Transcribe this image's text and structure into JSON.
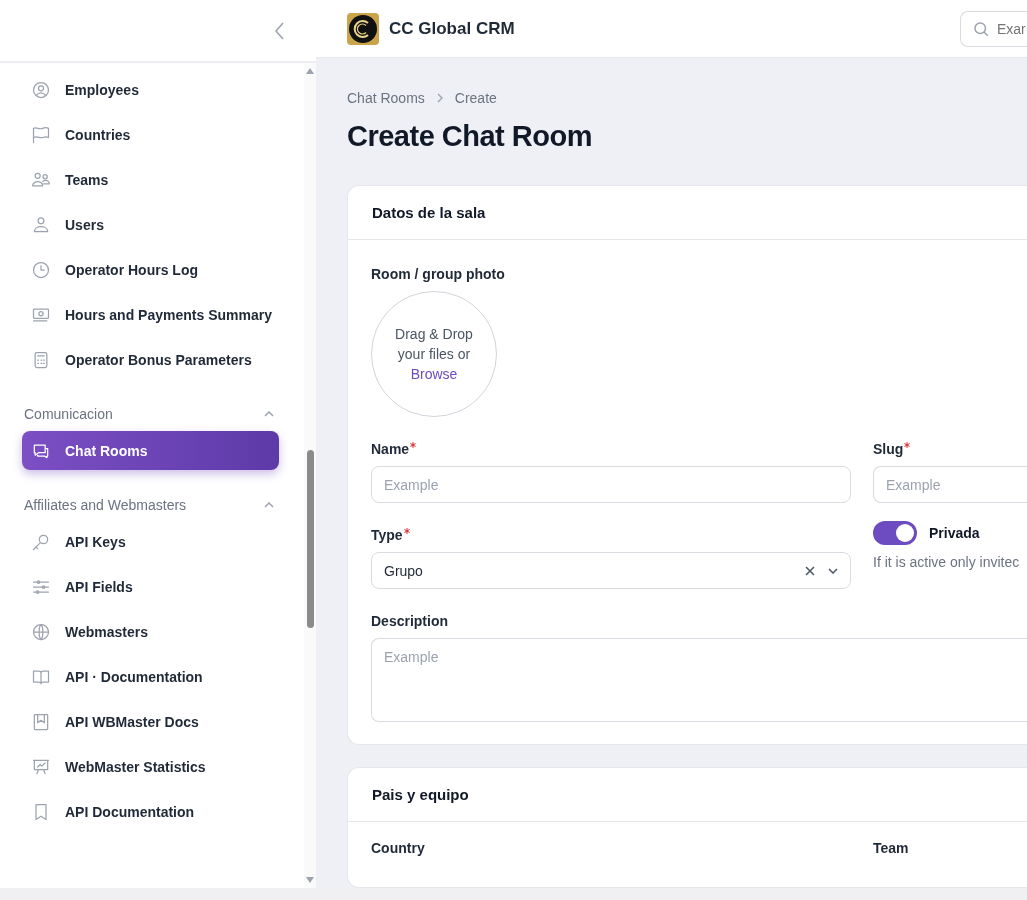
{
  "app": {
    "name": "CC Global CRM",
    "search": {
      "placeholder": "Exar"
    }
  },
  "sidebar": {
    "items": [
      {
        "label": "Employees",
        "selected": false
      },
      {
        "label": "Countries",
        "selected": false
      },
      {
        "label": "Teams",
        "selected": false
      },
      {
        "label": "Users",
        "selected": false
      },
      {
        "label": "Operator Hours Log",
        "selected": false
      },
      {
        "label": "Hours and Payments Summary",
        "selected": false
      },
      {
        "label": "Operator Bonus Parameters",
        "selected": false
      }
    ],
    "groups": [
      {
        "label": "Comunicacion",
        "expanded": true,
        "items": [
          {
            "label": "Chat Rooms",
            "selected": true
          }
        ]
      },
      {
        "label": "Affiliates and Webmasters",
        "expanded": true,
        "items": [
          {
            "label": "API Keys",
            "selected": false
          },
          {
            "label": "API Fields",
            "selected": false
          },
          {
            "label": "Webmasters",
            "selected": false
          },
          {
            "label": "API · Documentation",
            "selected": false
          },
          {
            "label": "API WBMaster Docs",
            "selected": false
          },
          {
            "label": "WebMaster Statistics",
            "selected": false
          },
          {
            "label": "API Documentation",
            "selected": false
          }
        ]
      }
    ]
  },
  "breadcrumbs": [
    "Chat Rooms",
    "Create"
  ],
  "title": "Create Chat Room",
  "sections": [
    {
      "title": "Datos de la sala",
      "photo": {
        "label": "Room / group photo",
        "text": "Drag & Drop your files or",
        "link": "Browse"
      },
      "name": {
        "label": "Name",
        "required": true,
        "placeholder": "Example"
      },
      "slug": {
        "label": "Slug",
        "required": true,
        "placeholder": "Example"
      },
      "type": {
        "label": "Type",
        "required": true,
        "value": "Grupo"
      },
      "private": {
        "label": "Privada",
        "on": true,
        "hint": "If it is active only invitec"
      },
      "description": {
        "label": "Description",
        "placeholder": "Example"
      }
    },
    {
      "title": "Pais y equipo",
      "country": {
        "label": "Country"
      },
      "team": {
        "label": "Team"
      }
    }
  ]
}
